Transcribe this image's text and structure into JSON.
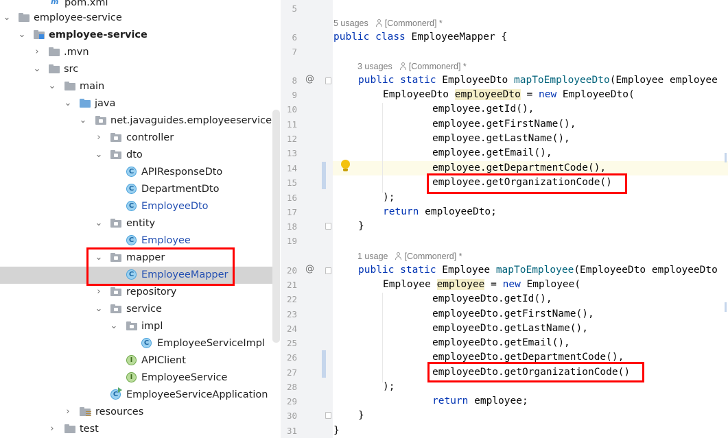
{
  "tree": {
    "items": [
      {
        "label": "pom.xml"
      },
      {
        "label": "employee-service"
      },
      {
        "label": "employee-service"
      },
      {
        "label": ".mvn"
      },
      {
        "label": "src"
      },
      {
        "label": "main"
      },
      {
        "label": "java"
      },
      {
        "label": "net.javaguides.employeeservice"
      },
      {
        "label": "controller"
      },
      {
        "label": "dto"
      },
      {
        "label": "APIResponseDto"
      },
      {
        "label": "DepartmentDto"
      },
      {
        "label": "EmployeeDto"
      },
      {
        "label": "entity"
      },
      {
        "label": "Employee"
      },
      {
        "label": "mapper"
      },
      {
        "label": "EmployeeMapper"
      },
      {
        "label": "repository"
      },
      {
        "label": "service"
      },
      {
        "label": "impl"
      },
      {
        "label": "EmployeeServiceImpl"
      },
      {
        "label": "APIClient"
      },
      {
        "label": "EmployeeService"
      },
      {
        "label": "EmployeeServiceApplication"
      },
      {
        "label": "resources"
      },
      {
        "label": "test"
      }
    ],
    "class_badge": "C",
    "interface_badge": "I"
  },
  "editor": {
    "line_numbers": [
      "5",
      "6",
      "7",
      "8",
      "9",
      "10",
      "11",
      "12",
      "13",
      "14",
      "15",
      "16",
      "17",
      "18",
      "19",
      "20",
      "21",
      "22",
      "23",
      "24",
      "25",
      "26",
      "27",
      "28",
      "29",
      "30",
      "31"
    ],
    "gutter_annotation": "@",
    "hints": {
      "class_usages": "5 usages",
      "method1_usages": "3 usages",
      "method2_usages": "1 usage",
      "author": "[Commonerd] *"
    },
    "tokens": {
      "kw_public": "public",
      "kw_class": "class",
      "kw_static": "static",
      "kw_new": "new",
      "kw_return": "return",
      "class_name": "EmployeeMapper",
      "open_brace": " {",
      "t_employee_dto": "EmployeeDto",
      "t_employee": "Employee",
      "m1_name": "mapToEmployeeDto",
      "m1_params": "(Employee employee",
      "m2_name": "mapToEmployee",
      "m2_params": "(EmployeeDto employeeDto",
      "v_employee_dto": "employeeDto",
      "v_employee": "employee",
      "assign": " = ",
      "ctor_dto_open": " EmployeeDto(",
      "ctor_emp_open": " Employee(",
      "close_paren": ");",
      "close_brace": "}",
      "ret_dto": " employeeDto;",
      "ret_emp": " employee;"
    },
    "method1_args": [
      "employee.getId(),",
      "employee.getFirstName(),",
      "employee.getLastName(),",
      "employee.getEmail(),",
      "employee.getDepartmentCode(),",
      "employee.getOrganizationCode()"
    ],
    "method2_args": [
      "employeeDto.getId(),",
      "employeeDto.getFirstName(),",
      "employeeDto.getLastName(),",
      "employeeDto.getEmail(),",
      "employeeDto.getDepartmentCode(),",
      "employeeDto.getOrganizationCode()"
    ]
  },
  "colors": {
    "highlight_box": "#ff0000",
    "keyword": "#0033b3",
    "method_name": "#00627a",
    "selected_row": "#d4d4d4"
  }
}
